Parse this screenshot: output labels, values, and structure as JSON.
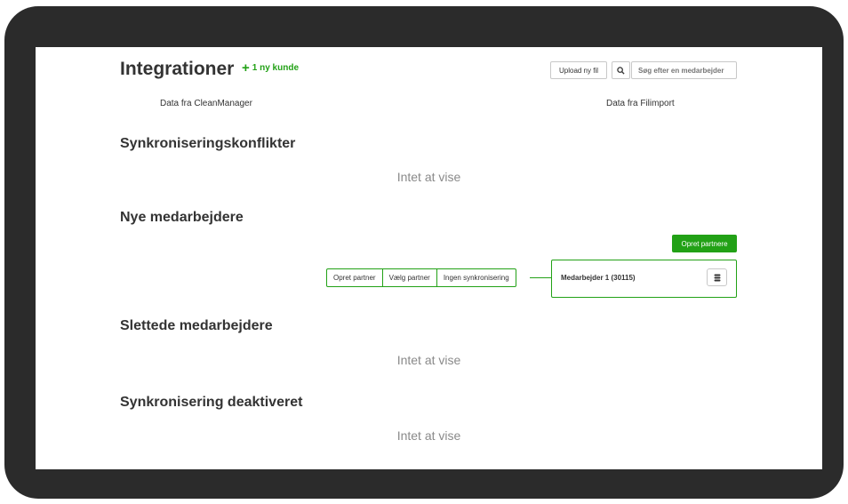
{
  "header": {
    "title": "Integrationer",
    "new_customer_plus": "+",
    "new_customer_label": "1 ny kunde",
    "upload_label": "Upload ny fil",
    "search_placeholder": "Søg efter en medarbejder"
  },
  "columns": {
    "left": "Data fra CleanManager",
    "right": "Data fra Filimport"
  },
  "sections": {
    "conflicts": {
      "title": "Synkroniseringskonflikter",
      "empty": "Intet at vise"
    },
    "new_employees": {
      "title": "Nye medarbejdere",
      "create_partners_label": "Opret partnere",
      "actions": [
        "Opret partner",
        "Vælg partner",
        "Ingen synkronisering"
      ],
      "employee": "Medarbejder 1 (30115)"
    },
    "deleted": {
      "title": "Slettede medarbejdere",
      "empty": "Intet at vise"
    },
    "disabled": {
      "title": "Synkronisering deaktiveret",
      "empty": "Intet at vise"
    }
  },
  "icons": {
    "search": "search-icon",
    "database": "database-icon"
  },
  "colors": {
    "accent": "#22a116",
    "frame": "#2b2b2b",
    "text": "#333333",
    "muted": "#8a8a8a"
  }
}
